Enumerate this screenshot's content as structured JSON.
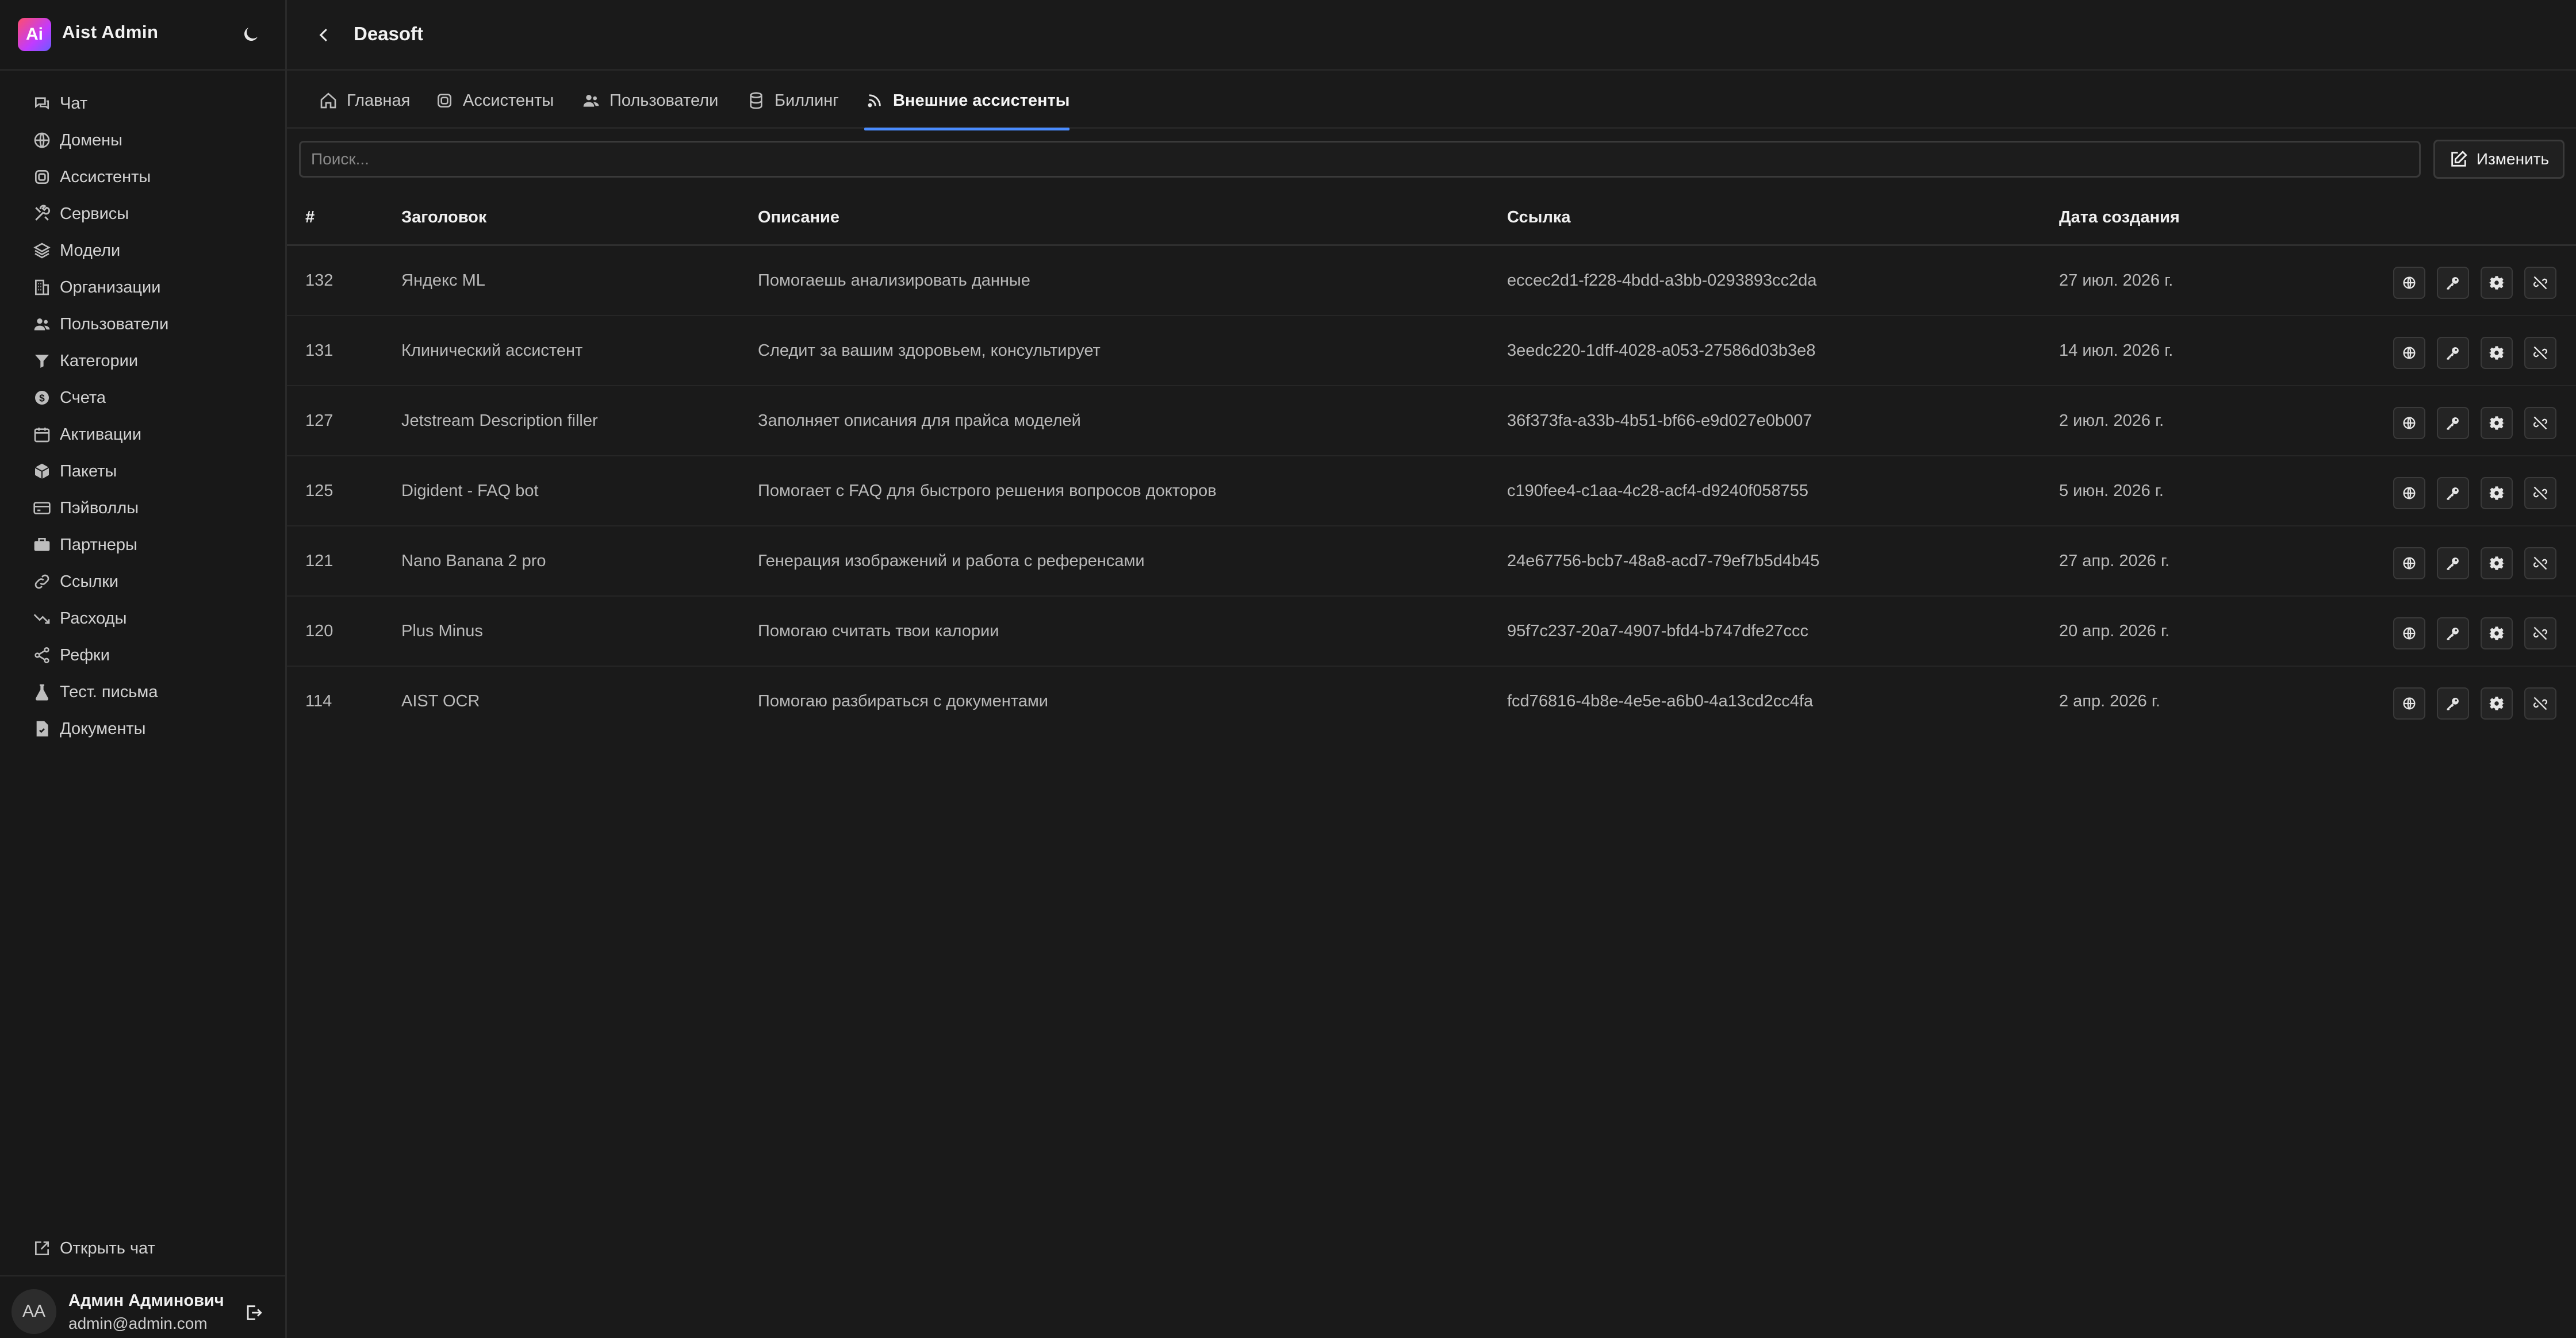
{
  "brand": {
    "logo_text": "Ai",
    "name": "Aist Admin"
  },
  "sidebar": {
    "items": [
      {
        "label": "Чат",
        "icon": "chat-icon"
      },
      {
        "label": "Домены",
        "icon": "globe-icon"
      },
      {
        "label": "Ассистенты",
        "icon": "cpu-icon"
      },
      {
        "label": "Сервисы",
        "icon": "tools-icon"
      },
      {
        "label": "Модели",
        "icon": "layers-icon"
      },
      {
        "label": "Организации",
        "icon": "building-icon"
      },
      {
        "label": "Пользователи",
        "icon": "users-icon"
      },
      {
        "label": "Категории",
        "icon": "filter-icon"
      },
      {
        "label": "Счета",
        "icon": "dollar-icon"
      },
      {
        "label": "Активации",
        "icon": "calendar-icon"
      },
      {
        "label": "Пакеты",
        "icon": "box-icon"
      },
      {
        "label": "Пэйволлы",
        "icon": "card-icon"
      },
      {
        "label": "Партнеры",
        "icon": "briefcase-icon"
      },
      {
        "label": "Ссылки",
        "icon": "link-icon"
      },
      {
        "label": "Расходы",
        "icon": "trend-down-icon"
      },
      {
        "label": "Рефки",
        "icon": "share-icon"
      },
      {
        "label": "Тест. письма",
        "icon": "flask-icon"
      },
      {
        "label": "Документы",
        "icon": "doc-check-icon"
      }
    ],
    "open_chat_label": "Открыть чат"
  },
  "user": {
    "initials": "AA",
    "name": "Админ Админович",
    "email": "admin@admin.com"
  },
  "header": {
    "title": "Deasoft"
  },
  "tabs": [
    {
      "label": "Главная",
      "icon": "home-icon",
      "active": false
    },
    {
      "label": "Ассистенты",
      "icon": "cpu-icon",
      "active": false
    },
    {
      "label": "Пользователи",
      "icon": "users-icon",
      "active": false
    },
    {
      "label": "Биллинг",
      "icon": "database-icon",
      "active": false
    },
    {
      "label": "Внешние ассистенты",
      "icon": "rss-icon",
      "active": true
    }
  ],
  "search": {
    "placeholder": "Поиск...",
    "value": ""
  },
  "edit_button": {
    "label": "Изменить"
  },
  "table": {
    "columns": [
      "#",
      "Заголовок",
      "Описание",
      "Ссылка",
      "Дата создания"
    ],
    "rows": [
      {
        "id": "132",
        "title": "Яндекс ML",
        "description": "Помогаешь анализировать данные",
        "link": "eccec2d1-f228-4bdd-a3bb-0293893cc2da",
        "created": "27 июл. 2026 г."
      },
      {
        "id": "131",
        "title": "Клинический ассистент",
        "description": "Следит за вашим здоровьем, консультирует",
        "link": "3eedc220-1dff-4028-a053-27586d03b3e8",
        "created": "14 июл. 2026 г."
      },
      {
        "id": "127",
        "title": "Jetstream Description filler",
        "description": "Заполняет описания для прайса моделей",
        "link": "36f373fa-a33b-4b51-bf66-e9d027e0b007",
        "created": "2 июл. 2026 г."
      },
      {
        "id": "125",
        "title": "Digident - FAQ bot",
        "description": "Помогает с FAQ для быстрого решения вопросов докторов",
        "link": "c190fee4-c1aa-4c28-acf4-d9240f058755",
        "created": "5 июн. 2026 г."
      },
      {
        "id": "121",
        "title": "Nano Banana 2 pro",
        "description": "Генерация изображений и работа с референсами",
        "link": "24e67756-bcb7-48a8-acd7-79ef7b5d4b45",
        "created": "27 апр. 2026 г."
      },
      {
        "id": "120",
        "title": "Plus Minus",
        "description": "Помогаю считать твои калории",
        "link": "95f7c237-20a7-4907-bfd4-b747dfe27ccc",
        "created": "20 апр. 2026 г."
      },
      {
        "id": "114",
        "title": "AIST OCR",
        "description": "Помогаю разбираться с документами",
        "link": "fcd76816-4b8e-4e5e-a6b0-4a13cd2cc4fa",
        "created": "2 апр. 2026 г."
      }
    ],
    "row_actions": [
      "globe-icon",
      "key-icon",
      "gear-icon",
      "unlink-icon"
    ]
  },
  "colors": {
    "background": "#1a1a1a",
    "sidebar": "#181818",
    "accent": "#4a8cff",
    "logo_gradient_start": "#ff4d6d",
    "logo_gradient_end": "#6a5cff"
  }
}
